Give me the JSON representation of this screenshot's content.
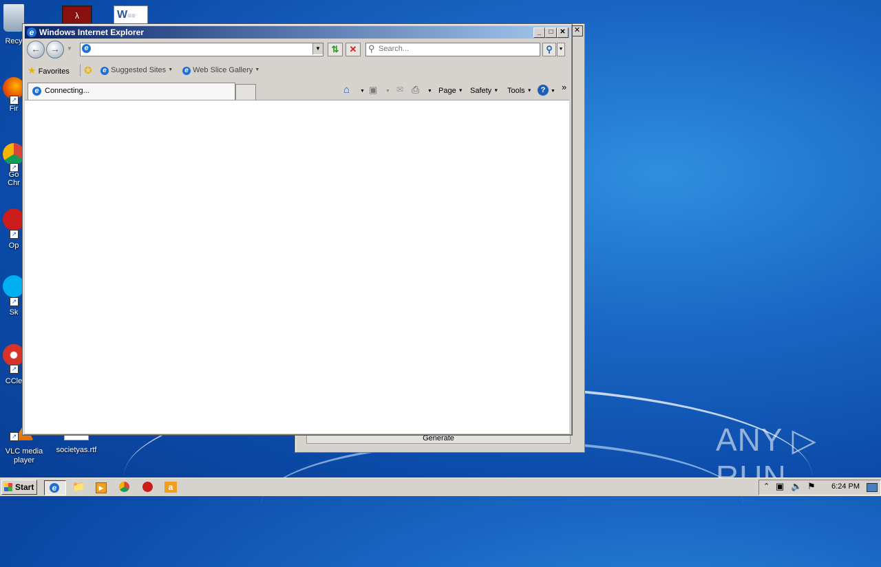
{
  "desktop": {
    "icons": [
      {
        "label": "Recy",
        "icon": "recycle-bin-icon"
      },
      {
        "label": "Fir",
        "icon": "firefox-icon"
      },
      {
        "label": "Go\nChr",
        "icon": "chrome-icon"
      },
      {
        "label": "Op",
        "icon": "opera-icon"
      },
      {
        "label": "Sk",
        "icon": "skype-icon"
      },
      {
        "label": "CCle",
        "icon": "ccleaner-icon"
      },
      {
        "label": "VLC media player",
        "icon": "vlc-icon"
      },
      {
        "label": "societyas.rtf",
        "icon": "rtf-file-icon"
      }
    ],
    "top_icons": [
      "acrobat-icon",
      "word-icon"
    ]
  },
  "background_window": {
    "close_label": "✕",
    "button_label": "Generate"
  },
  "ie": {
    "title": "Windows Internet Explorer",
    "title_buttons": {
      "minimize": "_",
      "maximize": "□",
      "close": "✕"
    },
    "address": {
      "value": "",
      "placeholder": ""
    },
    "search": {
      "placeholder": "Search..."
    },
    "favorites_label": "Favorites",
    "suggested_sites": "Suggested Sites",
    "web_slice_gallery": "Web Slice Gallery",
    "tab_label": "Connecting...",
    "commands": {
      "page": "Page",
      "safety": "Safety",
      "tools": "Tools",
      "more": "»"
    }
  },
  "watermark": "ANY ▷ RUN",
  "taskbar": {
    "start_label": "Start",
    "apps": [
      "ie-icon",
      "explorer-icon",
      "media-player-icon",
      "chrome-icon",
      "opera-icon",
      "amazon-icon"
    ],
    "clock": "6:24 PM"
  },
  "colors": {
    "desktop": "#1a66c4",
    "titlebar_start": "#0a246a",
    "titlebar_end": "#a6caf0",
    "chrome": "#d6d3ce"
  }
}
